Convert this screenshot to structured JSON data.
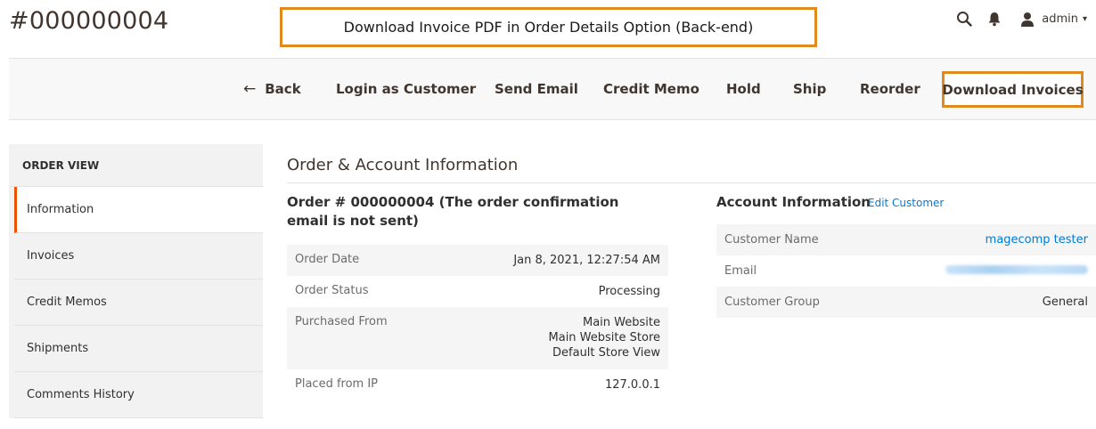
{
  "header": {
    "title": "#000000004",
    "callout": "Download Invoice PDF in Order Details Option (Back-end)",
    "icons": [
      "search-icon",
      "bell-icon",
      "user-icon"
    ],
    "admin_label": "admin",
    "admin_caret": "▾"
  },
  "actions": {
    "back_arrow": "←",
    "back": "Back",
    "login_as_customer": "Login as Customer",
    "send_email": "Send Email",
    "credit_memo": "Credit Memo",
    "hold": "Hold",
    "ship": "Ship",
    "reorder": "Reorder",
    "download_invoices": "Download Invoices"
  },
  "sidebar": {
    "heading": "ORDER VIEW",
    "items": [
      {
        "label": "Information",
        "active": true
      },
      {
        "label": "Invoices"
      },
      {
        "label": "Credit Memos"
      },
      {
        "label": "Shipments"
      },
      {
        "label": "Comments History"
      }
    ]
  },
  "main": {
    "section_title": "Order & Account Information",
    "order_heading": "Order # 000000004 (The order confirmation email is not sent)",
    "order_rows": [
      {
        "label": "Order Date",
        "value": "Jan 8, 2021, 12:27:54 AM"
      },
      {
        "label": "Order Status",
        "value": "Processing"
      },
      {
        "label": "Purchased From",
        "value_lines": [
          "Main Website",
          "Main Website Store",
          "Default Store View"
        ]
      },
      {
        "label": "Placed from IP",
        "value": "127.0.0.1"
      }
    ],
    "account": {
      "heading": "Account Information",
      "edit_link": "Edit Customer",
      "rows": [
        {
          "label": "Customer Name",
          "value": "magecomp tester"
        },
        {
          "label": "Email",
          "value": ""
        },
        {
          "label": "Customer Group",
          "value": "General"
        }
      ]
    }
  },
  "colors": {
    "callout_border": "#e08a1e",
    "active_tab_accent": "#eb5202",
    "link": "#007bdb"
  }
}
